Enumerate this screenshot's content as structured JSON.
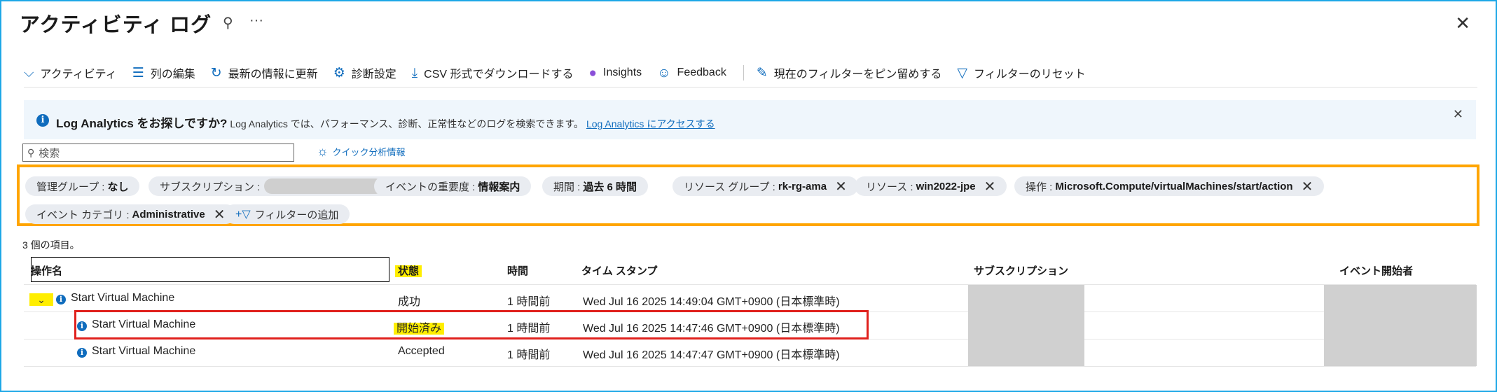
{
  "header": {
    "title": "アクティビティ ログ",
    "pin_glyph": "⚲",
    "more_glyph": "···",
    "close_glyph": "✕"
  },
  "toolbar": {
    "activity": "アクティビティ",
    "edit_columns": "列の編集",
    "refresh": "最新の情報に更新",
    "diagnostics": "診断設定",
    "download_csv": "CSV 形式でダウンロードする",
    "insights": "Insights",
    "feedback": "Feedback",
    "pin_filters": "現在のフィルターをピン留めする",
    "reset_filters": "フィルターのリセット"
  },
  "banner": {
    "heading": "Log Analytics をお探しですか?",
    "body": "Log Analytics では、パフォーマンス、診断、正常性などのログを検索できます。",
    "link": "Log Analytics にアクセスする"
  },
  "search": {
    "placeholder": "検索"
  },
  "quick_insights": "クイック分析情報",
  "filters": {
    "mgmt_group_label": "管理グループ :",
    "mgmt_group_value": "なし",
    "subscription_label": "サブスクリプション :",
    "severity_label": "イベントの重要度 :",
    "severity_value": "情報案内",
    "period_label": "期間 :",
    "period_value": "過去 6 時間",
    "rg_label": "リソース グループ :",
    "rg_value": "rk-rg-ama",
    "resource_label": "リソース :",
    "resource_value": "win2022-jpe",
    "op_label": "操作 :",
    "op_value": "Microsoft.Compute/virtualMachines/start/action",
    "category_label": "イベント カテゴリ :",
    "category_value": "Administrative",
    "add_filter": "フィルターの追加"
  },
  "item_count": "3 個の項目。",
  "columns": {
    "op_name": "操作名",
    "status": "状態",
    "time": "時間",
    "timestamp": "タイム スタンプ",
    "subscription": "サブスクリプション",
    "initiator": "イベント開始者"
  },
  "rows": [
    {
      "op": "Start Virtual Machine",
      "status": "成功",
      "time": "1 時間前",
      "ts": "Wed Jul 16 2025 14:49:04 GMT+0900 (日本標準時)"
    },
    {
      "op": "Start Virtual Machine",
      "status": "開始済み",
      "time": "1 時間前",
      "ts": "Wed Jul 16 2025 14:47:46 GMT+0900 (日本標準時)"
    },
    {
      "op": "Start Virtual Machine",
      "status": "Accepted",
      "time": "1 時間前",
      "ts": "Wed Jul 16 2025 14:47:47 GMT+0900 (日本標準時)"
    }
  ],
  "colors": {
    "accent": "#0f6cbd",
    "highlight_yellow": "#ffee00",
    "filter_border": "#ffa500",
    "red_box": "#e0211d",
    "frame_border": "#1ea7e6"
  }
}
